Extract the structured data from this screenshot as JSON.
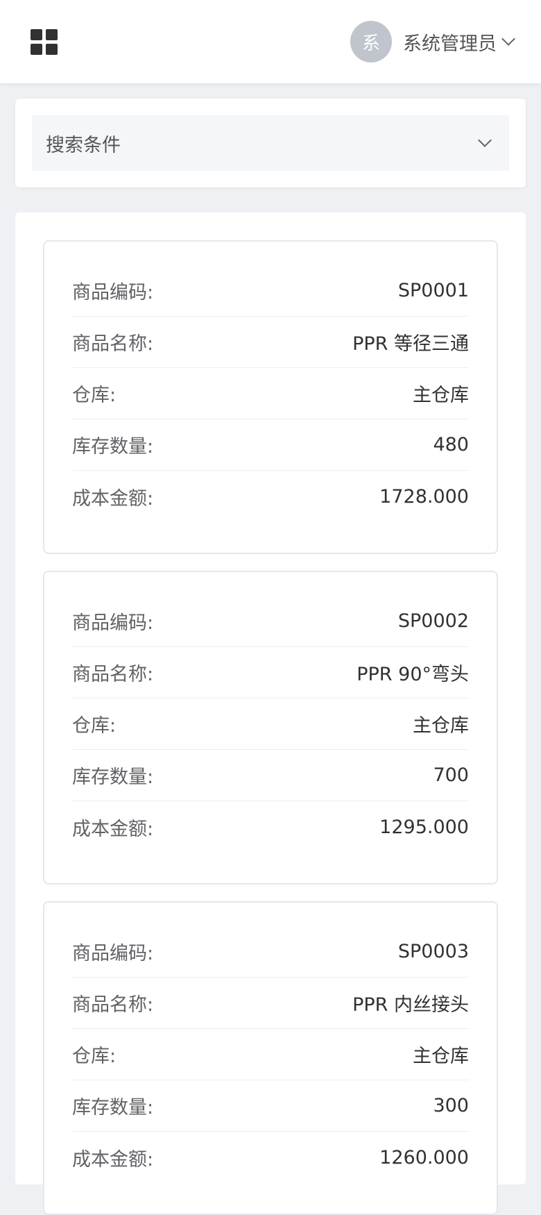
{
  "header": {
    "menu_icon": "grid-menu-icon",
    "avatar_text": "系",
    "user_name": "系统管理员",
    "dropdown_icon": "chevron-down-icon"
  },
  "search": {
    "title": "搜索条件",
    "toggle_icon": "chevron-down-icon"
  },
  "items": [
    {
      "code_label": "商品编码:",
      "code": "SP0001",
      "name_label": "商品名称:",
      "name": "PPR 等径三通",
      "warehouse_label": "仓库:",
      "warehouse": "主仓库",
      "qty_label": "库存数量:",
      "qty": "480",
      "cost_label": "成本金额:",
      "cost": "1728.000"
    },
    {
      "code_label": "商品编码:",
      "code": "SP0002",
      "name_label": "商品名称:",
      "name": "PPR 90°弯头",
      "warehouse_label": "仓库:",
      "warehouse": "主仓库",
      "qty_label": "库存数量:",
      "qty": "700",
      "cost_label": "成本金额:",
      "cost": "1295.000"
    },
    {
      "code_label": "商品编码:",
      "code": "SP0003",
      "name_label": "商品名称:",
      "name": "PPR 内丝接头",
      "warehouse_label": "仓库:",
      "warehouse": "主仓库",
      "qty_label": "库存数量:",
      "qty": "300",
      "cost_label": "成本金额:",
      "cost": "1260.000"
    }
  ]
}
